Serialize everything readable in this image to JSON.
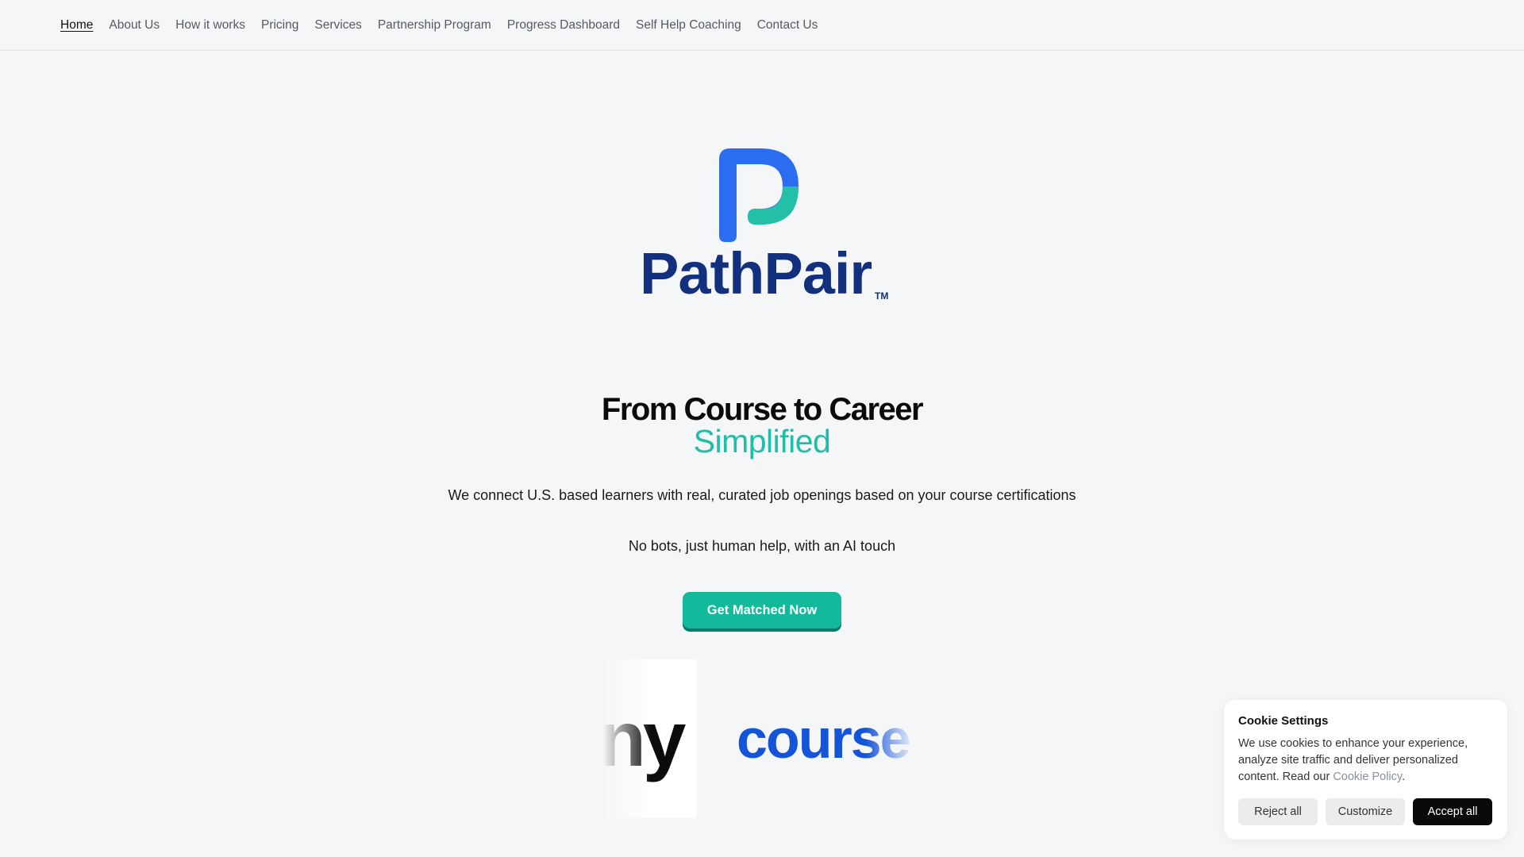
{
  "nav": {
    "items": [
      {
        "label": "Home",
        "active": true
      },
      {
        "label": "About Us"
      },
      {
        "label": "How it works"
      },
      {
        "label": "Pricing"
      },
      {
        "label": "Services"
      },
      {
        "label": "Partnership Program"
      },
      {
        "label": "Progress Dashboard"
      },
      {
        "label": "Self Help Coaching"
      },
      {
        "label": "Contact Us"
      }
    ]
  },
  "brand": {
    "name": "PathPair",
    "tm": "TM",
    "colors": {
      "primary": "#2a6df0",
      "teal": "#23bfa7",
      "navy": "#13307f"
    }
  },
  "hero": {
    "title": "From Course to Career",
    "subtitle": "Simplified",
    "description": "We connect U.S. based learners with real, curated job openings based on your course certifications",
    "tagline": "No bots, just human help, with an AI touch",
    "cta_label": "Get Matched Now",
    "accent_color": "#12b99a"
  },
  "partners": {
    "fragment_left": "ny",
    "fragment_right": "course"
  },
  "cookie": {
    "title": "Cookie Settings",
    "text": "We use cookies to enhance your experience, analyze site traffic and deliver personalized content. Read our ",
    "link": "Cookie Policy",
    "text_end": ".",
    "reject_label": "Reject all",
    "customize_label": "Customize",
    "accept_label": "Accept all"
  }
}
